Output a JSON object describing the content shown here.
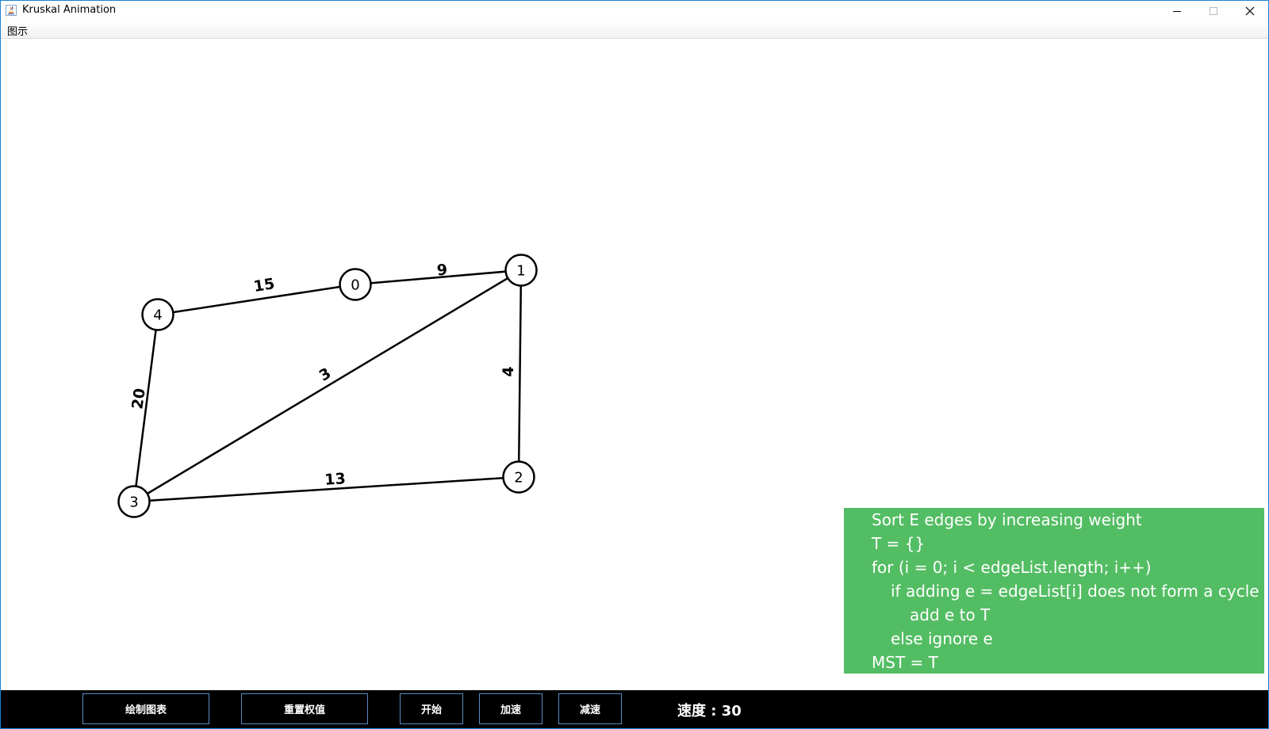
{
  "window": {
    "title": "Kruskal Animation",
    "minimize_glyph": "—",
    "maximize_glyph": "☐",
    "close_glyph": "✕"
  },
  "menubar": {
    "items": [
      {
        "label": "图示"
      }
    ]
  },
  "graph": {
    "nodes": [
      {
        "id": "0",
        "label": "0"
      },
      {
        "id": "1",
        "label": "1"
      },
      {
        "id": "2",
        "label": "2"
      },
      {
        "id": "3",
        "label": "3"
      },
      {
        "id": "4",
        "label": "4"
      }
    ],
    "edges": [
      {
        "from": "4",
        "to": "0",
        "weight": "15"
      },
      {
        "from": "0",
        "to": "1",
        "weight": "9"
      },
      {
        "from": "1",
        "to": "3",
        "weight": "3"
      },
      {
        "from": "1",
        "to": "2",
        "weight": "4"
      },
      {
        "from": "4",
        "to": "3",
        "weight": "20"
      },
      {
        "from": "3",
        "to": "2",
        "weight": "13"
      }
    ]
  },
  "pseudocode": {
    "lines": [
      "Sort E edges by increasing weight",
      "T = {}",
      "for (i = 0; i < edgeList.length; i++)",
      "if adding e = edgeList[i] does not form a cycle",
      "add e to T",
      "else ignore e",
      "MST = T"
    ],
    "background_color": "#53bd63"
  },
  "controls": {
    "draw_graph": "绘制图表",
    "reset_weights": "重置权值",
    "start": "开始",
    "speed_up": "加速",
    "slow_down": "减速",
    "speed_text": "速度 : 30"
  }
}
